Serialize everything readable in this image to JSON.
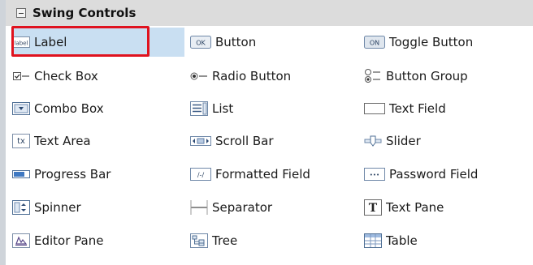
{
  "palette": {
    "title": "Swing Controls",
    "columns": [
      [
        {
          "label": "Label",
          "icon": "label-icon",
          "selected": true
        },
        {
          "label": "Check Box",
          "icon": "checkbox-icon"
        },
        {
          "label": "Combo Box",
          "icon": "combo-box-icon"
        },
        {
          "label": "Text Area",
          "icon": "text-area-icon"
        },
        {
          "label": "Progress Bar",
          "icon": "progress-bar-icon"
        },
        {
          "label": "Spinner",
          "icon": "spinner-icon"
        },
        {
          "label": "Editor Pane",
          "icon": "editor-pane-icon"
        }
      ],
      [
        {
          "label": "Button",
          "icon": "button-icon"
        },
        {
          "label": "Radio Button",
          "icon": "radio-button-icon"
        },
        {
          "label": "List",
          "icon": "list-icon"
        },
        {
          "label": "Scroll Bar",
          "icon": "scroll-bar-icon"
        },
        {
          "label": "Formatted Field",
          "icon": "formatted-field-icon"
        },
        {
          "label": "Separator",
          "icon": "separator-icon"
        },
        {
          "label": "Tree",
          "icon": "tree-icon"
        }
      ],
      [
        {
          "label": "Toggle Button",
          "icon": "toggle-button-icon"
        },
        {
          "label": "Button Group",
          "icon": "button-group-icon"
        },
        {
          "label": "Text Field",
          "icon": "text-field-icon"
        },
        {
          "label": "Slider",
          "icon": "slider-icon"
        },
        {
          "label": "Password Field",
          "icon": "password-field-icon"
        },
        {
          "label": "Text Pane",
          "icon": "text-pane-icon"
        },
        {
          "label": "Table",
          "icon": "table-icon"
        }
      ]
    ],
    "icon_text": {
      "label": "label",
      "ok": "OK",
      "on": "ON",
      "tx": "tx",
      "T": "T",
      "dots": "•••",
      "fmt": "/-/"
    },
    "colors": {
      "selection": "#c9dff2",
      "highlight_border": "#e0121e",
      "header_bg": "#dcdcdc"
    }
  }
}
